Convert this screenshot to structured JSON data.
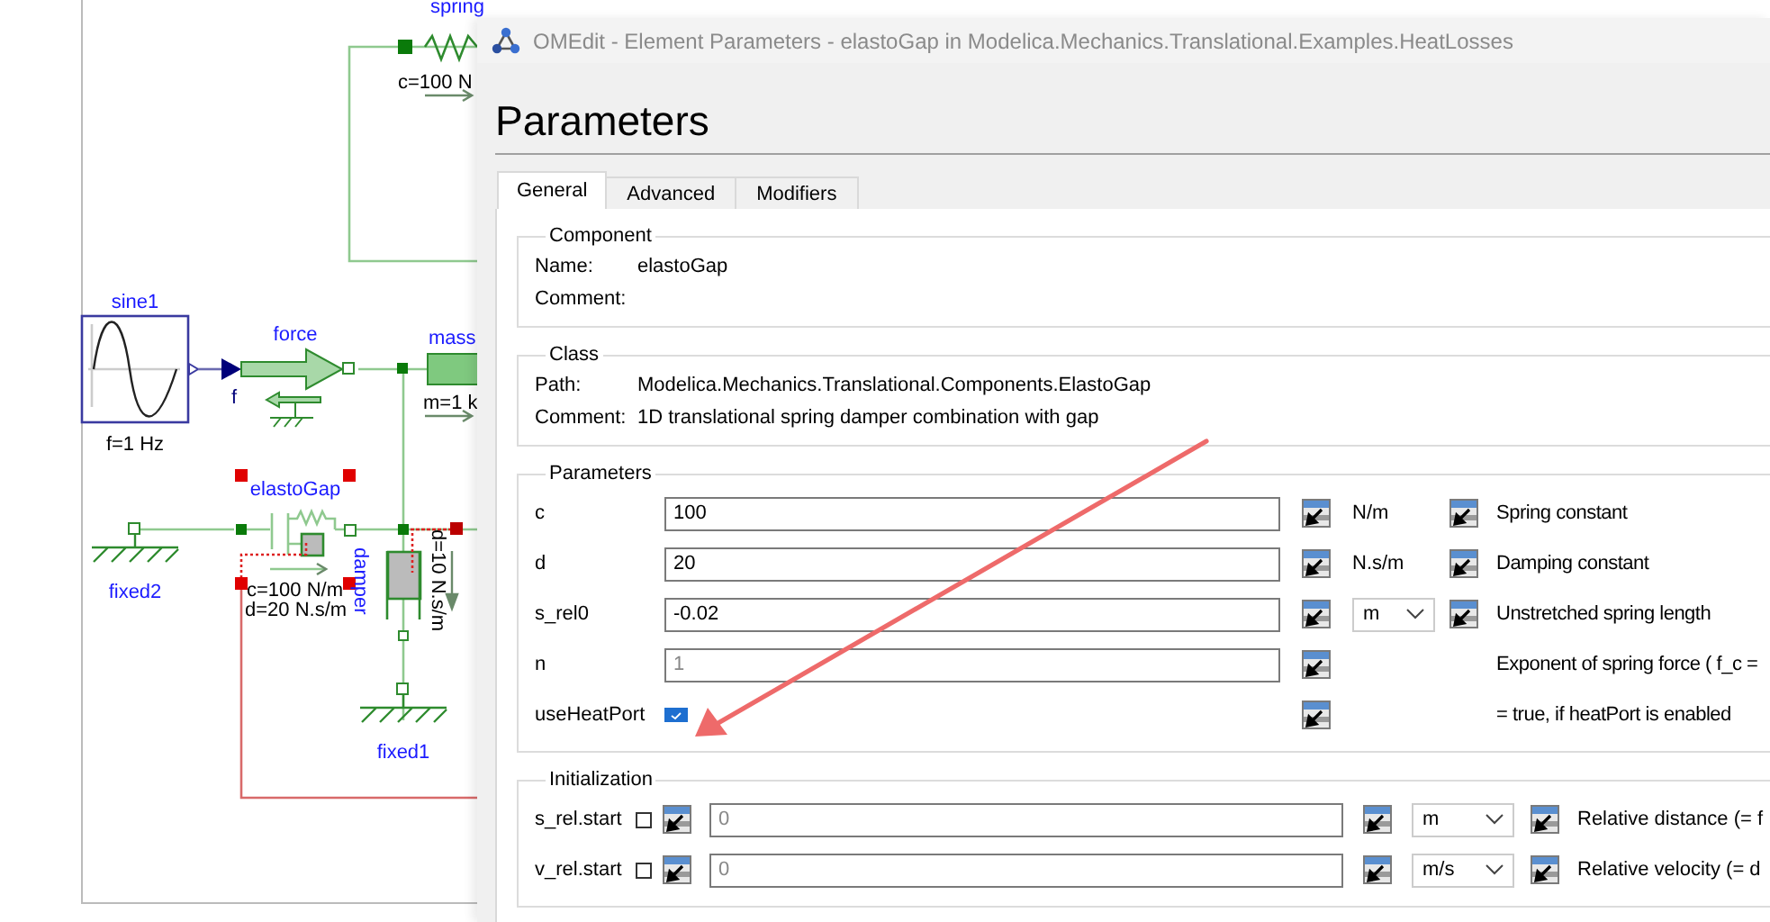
{
  "diagram": {
    "spring": {
      "name": "spring",
      "parameters": [
        "c=100 N"
      ]
    },
    "sine": {
      "name": "sine1",
      "parameters": [
        "f=1 Hz"
      ]
    },
    "force": {
      "name": "force",
      "port": "f"
    },
    "mass": {
      "name": "mass",
      "parameters": [
        "m=1 k"
      ]
    },
    "elasto_gap": {
      "name": "elastoGap",
      "selected": true,
      "parameters": [
        "c=100 N/m",
        "d=20 N.s/m"
      ]
    },
    "damper": {
      "name": "damper",
      "parameters": [
        "d=10 N.s/m"
      ]
    },
    "fixed2": {
      "name": "fixed2"
    },
    "fixed1": {
      "name": "fixed1"
    }
  },
  "window": {
    "title": "OMEdit - Element Parameters - elastoGap in Modelica.Mechanics.Translational.Examples.HeatLosses"
  },
  "heading": "Parameters",
  "tabs": [
    {
      "label": "General",
      "selected": true
    },
    {
      "label": "Advanced",
      "selected": false
    },
    {
      "label": "Modifiers",
      "selected": false
    }
  ],
  "component": {
    "title": "Component",
    "rows": [
      {
        "label": "Name:",
        "value": "elastoGap"
      },
      {
        "label": "Comment:"
      }
    ]
  },
  "class": {
    "title": "Class",
    "rows": [
      {
        "label": "Path:",
        "value": "Modelica.Mechanics.Translational.Components.ElastoGap"
      },
      {
        "label": "Comment:",
        "value": "1D translational spring damper combination with gap"
      }
    ]
  },
  "parameters": {
    "title": "Parameters",
    "rows": [
      {
        "kind": "field",
        "name": "c",
        "value": "100",
        "unit": {
          "kind": "label",
          "text": "N/m"
        },
        "description": "Spring constant"
      },
      {
        "kind": "field",
        "name": "d",
        "value": "20",
        "unit": {
          "kind": "label",
          "text": "N.s/m"
        },
        "description": "Damping constant"
      },
      {
        "kind": "field",
        "name": "s_rel0",
        "value": "-0.02",
        "unit": {
          "kind": "select",
          "text": "m"
        },
        "description": "Unstretched spring length"
      },
      {
        "kind": "field",
        "name": "n",
        "placeholder": "1",
        "description": "Exponent of spring force ( f_c ="
      },
      {
        "kind": "checkbox",
        "name": "useHeatPort",
        "checked": true,
        "description": "= true, if heatPort is enabled"
      }
    ]
  },
  "initialization": {
    "title": "Initialization",
    "rows": [
      {
        "name": "s_rel.start",
        "fixed": false,
        "placeholder": "0",
        "unit": "m",
        "description": "Relative distance (= f"
      },
      {
        "name": "v_rel.start",
        "fixed": false,
        "placeholder": "0",
        "unit": "m/s",
        "description": "Relative velocity (= d"
      }
    ]
  }
}
